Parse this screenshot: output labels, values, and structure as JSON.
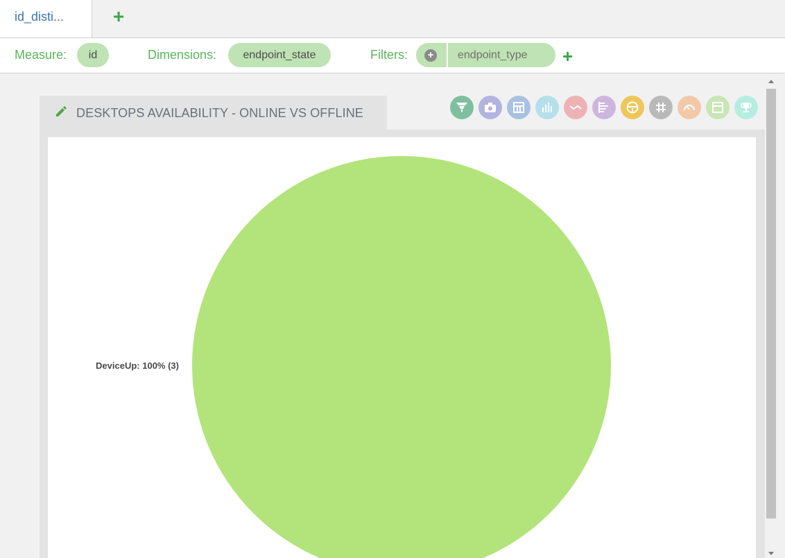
{
  "tabs": [
    {
      "label": "id_disti..."
    }
  ],
  "query": {
    "measure_label": "Measure:",
    "measure_value": "id",
    "dimensions_label": "Dimensions:",
    "dimension_value": "endpoint_state",
    "filters_label": "Filters:",
    "filter_value": "endpoint_type"
  },
  "panel": {
    "title": "DESKTOPS AVAILABILITY - ONLINE VS OFFLINE"
  },
  "toolbar": [
    {
      "name": "funnel-chart-button",
      "icon": "funnel-icon",
      "color": "#7fbf9f"
    },
    {
      "name": "snapshot-button",
      "icon": "camera-icon",
      "color": "#b3b3e0"
    },
    {
      "name": "table-view-button",
      "icon": "table-icon",
      "color": "#a9c1e0"
    },
    {
      "name": "bar-chart-button",
      "icon": "bar-chart-icon",
      "color": "#b5dfea"
    },
    {
      "name": "line-chart-button",
      "icon": "line-chart-icon",
      "color": "#eeb2b5"
    },
    {
      "name": "horizontal-bar-button",
      "icon": "horizontal-bar-icon",
      "color": "#cdb6de"
    },
    {
      "name": "steering-wheel-button",
      "icon": "steering-wheel-icon",
      "color": "#eec65a"
    },
    {
      "name": "number-view-button",
      "icon": "hash-icon",
      "color": "#b9b9b9"
    },
    {
      "name": "gauge-button",
      "icon": "gauge-icon",
      "color": "#f2c9a8"
    },
    {
      "name": "card-view-button",
      "icon": "card-icon",
      "color": "#c9e6b5"
    },
    {
      "name": "trophy-button",
      "icon": "trophy-icon",
      "color": "#b5ede1"
    }
  ],
  "colors": {
    "pie_slice": "#b3e47b",
    "accent_green": "#3aa64a"
  },
  "chart_data": {
    "type": "pie",
    "slices": [
      {
        "label": "DeviceUp",
        "value": 3,
        "percent": 100
      }
    ],
    "labels": [
      "DeviceUp: 100% (3)"
    ],
    "title": ""
  }
}
